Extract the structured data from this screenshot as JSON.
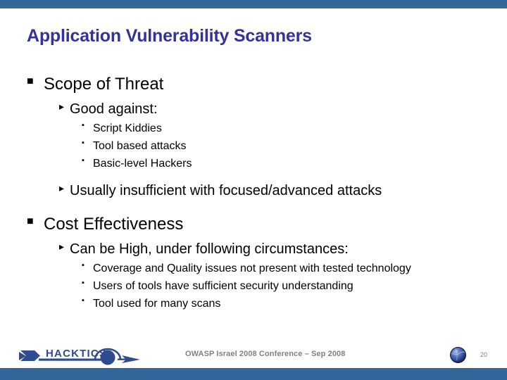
{
  "slide": {
    "title": "Application Vulnerability Scanners",
    "accent_bar_color": "#336699",
    "title_color": "#333399",
    "body_text_color": "#000000"
  },
  "bullets": {
    "level1_mark": "■",
    "level2_mark": "▸",
    "level3_mark": "▪",
    "items": [
      {
        "level": 1,
        "text": "Scope of Threat"
      },
      {
        "level": 2,
        "text": "Good against:"
      },
      {
        "level": 3,
        "text": "Script Kiddies"
      },
      {
        "level": 3,
        "text": "Tool based attacks"
      },
      {
        "level": 3,
        "text": "Basic-level Hackers"
      },
      {
        "level": 2,
        "text": "Usually insufficient with focused/advanced attacks"
      },
      {
        "level": 1,
        "text": "Cost Effectiveness"
      },
      {
        "level": 2,
        "text": "Can be High, under following circumstances:"
      },
      {
        "level": 3,
        "text": "Coverage and Quality issues not present with tested technology"
      },
      {
        "level": 3,
        "text": "Users of tools have sufficient security understanding"
      },
      {
        "level": 3,
        "text": "Tool used for many scans"
      }
    ]
  },
  "footer": {
    "conference": "OWASP Israel 2008 Conference – Sep 2008",
    "page_number": "20",
    "logo_wordmark": "HACKTICS",
    "logo_color": "#2E4C8E",
    "footer_text_color": "#808080",
    "globe_icon": "globe-icon"
  }
}
